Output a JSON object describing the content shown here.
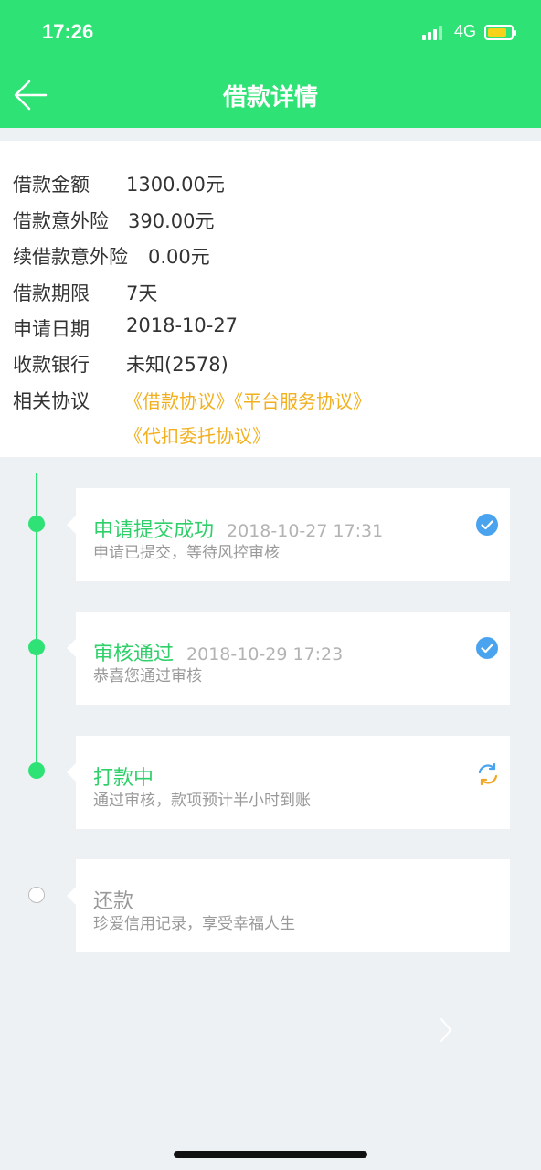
{
  "status_bar": {
    "time": "17:26",
    "network": "4G",
    "battery_level": 0.7
  },
  "nav": {
    "title": "借款详情"
  },
  "details": [
    {
      "label": "借款金额",
      "value": "1300.00元"
    },
    {
      "label": "借款意外险",
      "value": "390.00元"
    },
    {
      "label": "续借款意外险",
      "value": "0.00元"
    },
    {
      "label": "借款期限",
      "value": "7天"
    },
    {
      "label": "申请日期",
      "value": "2018-10-27"
    },
    {
      "label": "收款银行",
      "value": "未知(2578)"
    }
  ],
  "agreements": {
    "label": "相关协议",
    "links": [
      "《借款协议》",
      "《平台服务协议》",
      "《代扣委托协议》"
    ]
  },
  "timeline": [
    {
      "title": "申请提交成功",
      "time": "2018-10-27 17:31",
      "desc": "申请已提交，等待风控审核",
      "status": "done"
    },
    {
      "title": "审核通过",
      "time": "2018-10-29 17:23",
      "desc": "恭喜您通过审核",
      "status": "done"
    },
    {
      "title": "打款中",
      "time": "",
      "desc": "通过审核，款项预计半小时到账",
      "status": "in-progress"
    },
    {
      "title": "还款",
      "time": "",
      "desc": "珍爱信用记录，享受幸福人生",
      "status": "pending"
    }
  ],
  "colors": {
    "brand_green": "#2fe276",
    "link_orange": "#f2b01e",
    "check_blue": "#4aa3ee",
    "muted_gray": "#9a9a9a"
  },
  "icons": {
    "back": "arrow-left-icon",
    "done": "check-circle-icon",
    "in_progress": "refresh-icon",
    "more": "chevron-right-icon"
  }
}
